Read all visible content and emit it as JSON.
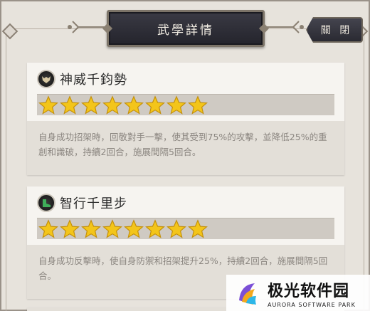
{
  "header": {
    "title": "武學詳情",
    "close_label": "關 閉"
  },
  "skills": [
    {
      "name": "神威千鈞勢",
      "icon": "beast-head-icon",
      "stars": 8,
      "description": "自身成功招架時，回敬對手一擊，使其受到75%的攻擊，並降低25%的重創和識破，持續2回合，施展間隔5回合。"
    },
    {
      "name": "智行千里步",
      "icon": "running-boot-icon",
      "stars": 8,
      "description": "自身成功反擊時，使自身防禦和招架提升25%，持續2回合，施展間隔5回合。"
    }
  ],
  "watermark": {
    "main": "极光软件园",
    "sub": "AURORA SOFTWARE PARK"
  },
  "colors": {
    "star": "#f3c51a",
    "banner": "#2c2c34",
    "parchment": "#e7e3dc"
  }
}
